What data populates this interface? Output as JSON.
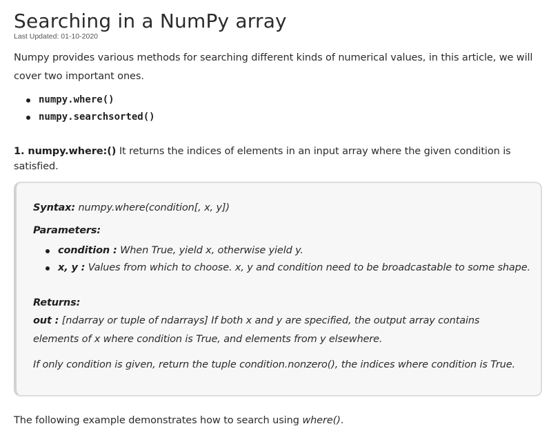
{
  "article": {
    "title": "Searching in a NumPy array",
    "last_updated": "Last Updated: 01-10-2020",
    "intro": "Numpy provides various methods for searching different kinds of numerical values, in this article, we will cover two important ones.",
    "methods": [
      "numpy.where()",
      "numpy.searchsorted()"
    ],
    "section1": {
      "heading": "1. numpy.where:()",
      "text": " It returns the indices of elements in an input array where the given condition is satisfied."
    },
    "box": {
      "syntax_label": "Syntax:",
      "syntax_text": " numpy.where(condition[, x, y])",
      "parameters_label": "Parameters:",
      "params": [
        {
          "name": "condition :",
          "desc": " When True, yield x, otherwise yield y."
        },
        {
          "name": "x, y :",
          "desc": " Values from which to choose. x, y and condition need to be broadcastable to some shape."
        }
      ],
      "returns_label": "Returns:",
      "out_label": "out :",
      "out_text": " [ndarray or tuple of ndarrays] If both x and y are specified, the output array contains elements of x where condition is True, and elements from y elsewhere.",
      "only_text": "If only condition is given, return the tuple condition.nonzero(), the indices where condition is True."
    },
    "footer": {
      "text": "The following example demonstrates how to search using ",
      "code": "where()",
      "end": "."
    }
  }
}
